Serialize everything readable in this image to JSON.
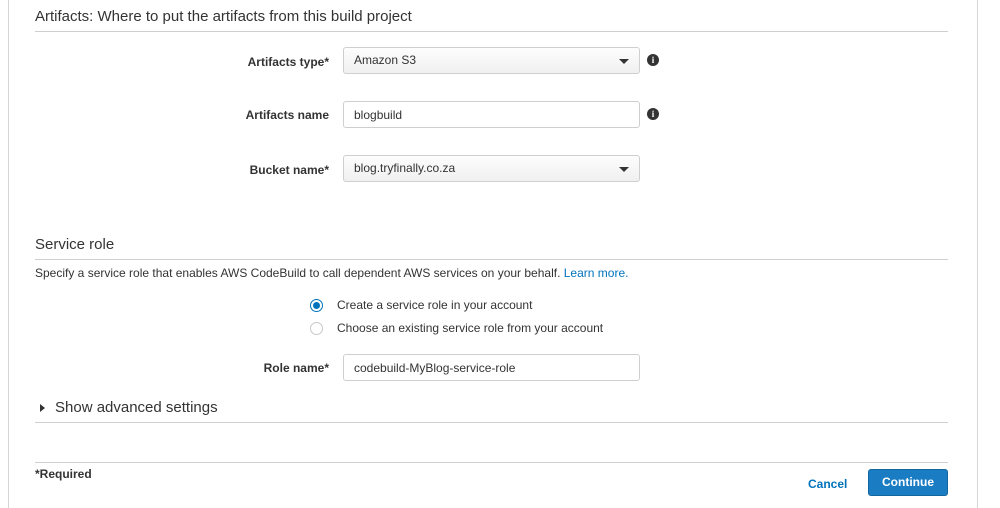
{
  "artifacts": {
    "section_title": "Artifacts: Where to put the artifacts from this build project",
    "type_label": "Artifacts type*",
    "type_value": "Amazon S3",
    "name_label": "Artifacts name",
    "name_value": "blogbuild",
    "bucket_label": "Bucket name*",
    "bucket_value": "blog.tryfinally.co.za",
    "info_glyph": "i"
  },
  "service_role": {
    "section_title": "Service role",
    "description": "Specify a service role that enables AWS CodeBuild to call dependent AWS services on your behalf.",
    "learn_more": "Learn more.",
    "option_create": "Create a service role in your account",
    "option_existing": "Choose an existing service role from your account",
    "role_name_label": "Role name*",
    "role_name_value": "codebuild-MyBlog-service-role"
  },
  "advanced": {
    "label": "Show advanced settings"
  },
  "footer": {
    "required": "*Required",
    "cancel": "Cancel",
    "continue": "Continue"
  },
  "colors": {
    "accent": "#0073bb",
    "primary_button": "#1a7dc4"
  }
}
